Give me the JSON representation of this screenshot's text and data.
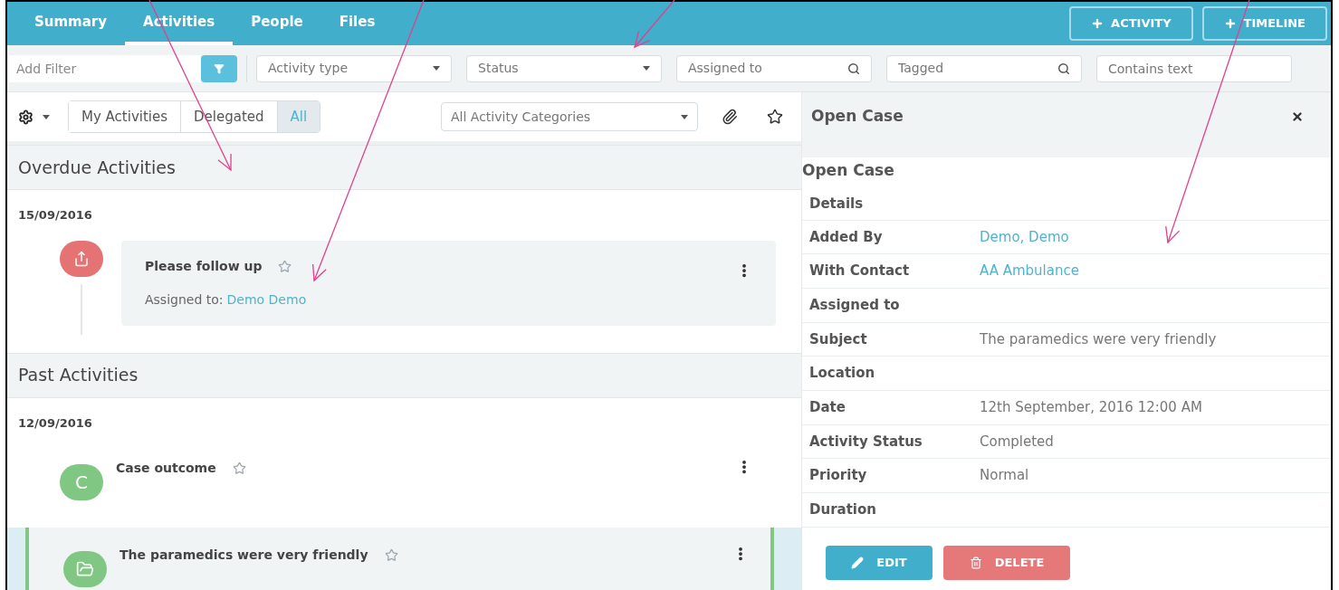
{
  "tabs": [
    {
      "label": "Summary",
      "selected": false
    },
    {
      "label": "Activities",
      "selected": true
    },
    {
      "label": "People",
      "selected": false
    },
    {
      "label": "Files",
      "selected": false
    }
  ],
  "header_buttons": [
    "ACTIVITY",
    "TIMELINE"
  ],
  "filters": [
    {
      "kind": "add",
      "placeholder": "Add Filter"
    },
    {
      "kind": "select",
      "placeholder": "Activity type"
    },
    {
      "kind": "select",
      "placeholder": "Status"
    },
    {
      "kind": "search",
      "placeholder": "Assigned to"
    },
    {
      "kind": "search",
      "placeholder": "Tagged"
    },
    {
      "kind": "text",
      "placeholder": "Contains text"
    }
  ],
  "view_toggle": [
    {
      "label": "My Activities",
      "selected": false
    },
    {
      "label": "Delegated",
      "selected": false
    },
    {
      "label": "All",
      "selected": true
    }
  ],
  "category_select": "All Activity Categories",
  "sections": [
    {
      "title": "Overdue Activities",
      "groups": [
        {
          "date": "15/09/2016",
          "activities": [
            {
              "kind": "overdue",
              "color": "#e57373",
              "title": "Please follow up",
              "starred": false,
              "selected": false,
              "assigned_label": "Assigned to:",
              "assigned_to": "Demo Demo"
            }
          ]
        }
      ]
    },
    {
      "title": "Past Activities",
      "groups": [
        {
          "date": "12/09/2016",
          "activities": [
            {
              "kind": "initial",
              "initial": "C",
              "color": "#81c784",
              "title": "Case outcome",
              "starred": false,
              "selected": false
            },
            {
              "kind": "folder",
              "color": "#81c784",
              "title": "The paramedics were very friendly",
              "starred": false,
              "selected": true
            }
          ]
        }
      ]
    }
  ],
  "detail": {
    "title": "Open Case",
    "heading": "Open Case",
    "section_label": "Details",
    "rows": [
      {
        "label": "Added By",
        "value": "Demo, Demo",
        "link": true
      },
      {
        "label": "With Contact",
        "value": "AA Ambulance",
        "link": true
      },
      {
        "label": "Assigned to"
      },
      {
        "label": "Subject",
        "value": "The paramedics were very friendly",
        "link": false
      },
      {
        "label": "Location"
      },
      {
        "label": "Date",
        "value": "12th September, 2016 12:00 AM",
        "link": false
      },
      {
        "label": "Activity Status",
        "value": "Completed",
        "link": false
      },
      {
        "label": "Priority",
        "value": "Normal",
        "link": false
      },
      {
        "label": "Duration"
      }
    ],
    "buttons": [
      {
        "kind": "edit",
        "label": "EDIT"
      },
      {
        "kind": "delete",
        "label": "DELETE"
      }
    ]
  }
}
